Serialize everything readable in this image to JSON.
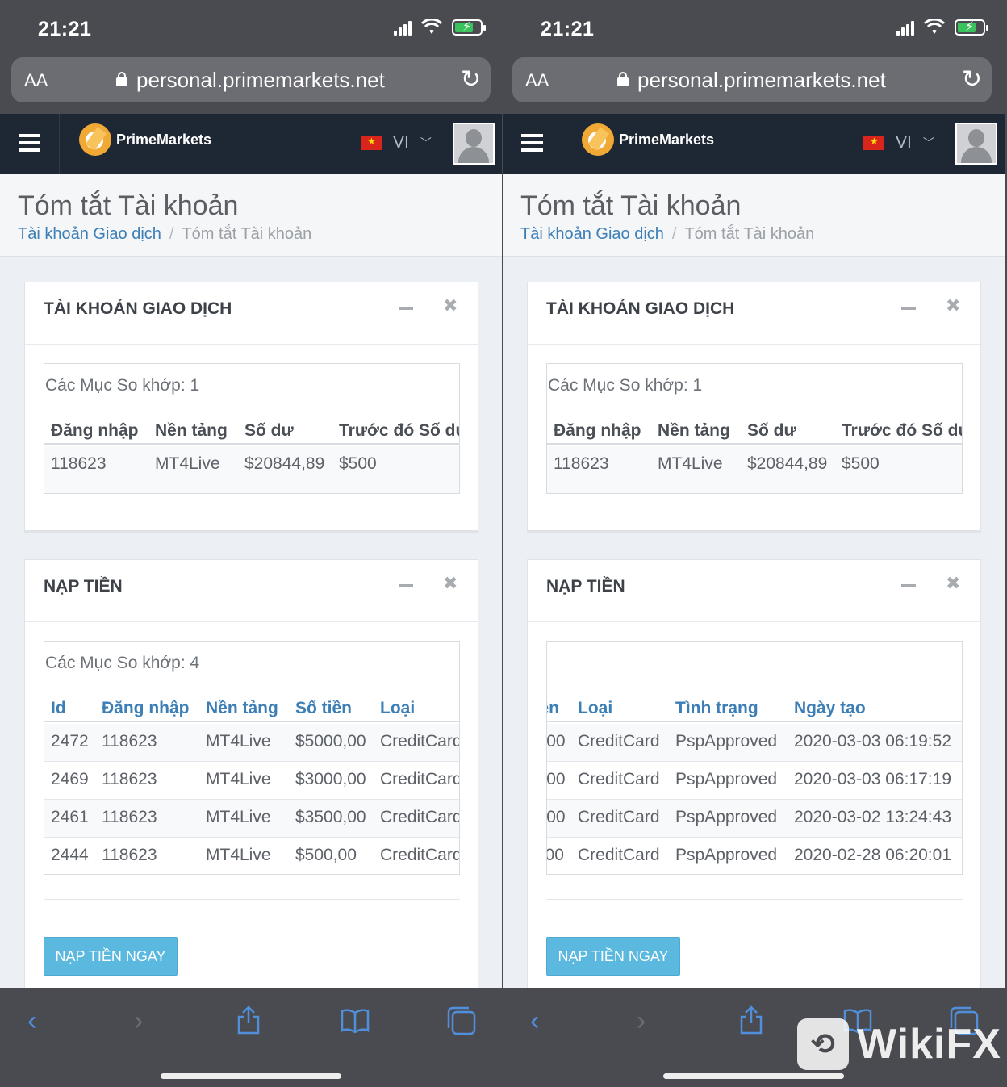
{
  "status": {
    "time": "21:21"
  },
  "browser": {
    "text_size": "AA",
    "url": "personal.primemarkets.net"
  },
  "app": {
    "brand": "PrimeMarkets",
    "language": "VI"
  },
  "page": {
    "title": "Tóm tắt Tài khoản",
    "breadcrumb": {
      "parent": "Tài khoản Giao dịch",
      "separator": "/",
      "current": "Tóm tắt Tài khoản"
    }
  },
  "trading_panel": {
    "title": "TÀI KHOẢN GIAO DỊCH",
    "count": "Các Mục So khớp: 1",
    "columns": [
      "Đăng nhập",
      "Nền tảng",
      "Số dư",
      "Trước đó Số dư"
    ],
    "rows": [
      [
        "118623",
        "MT4Live",
        "$20844,89",
        "$500"
      ]
    ]
  },
  "deposit_panel": {
    "title": "NẠP TIỀN",
    "count": "Các Mục So khớp: 4",
    "columns": [
      "Id",
      "Đăng nhập",
      "Nền tảng",
      "Số tiền",
      "Loại",
      "Tình trạng",
      "Ngày tạo"
    ],
    "rows": [
      [
        "2472",
        "118623",
        "MT4Live",
        "$5000,00",
        "CreditCard",
        "PspApproved",
        "2020-03-03 06:19:52"
      ],
      [
        "2469",
        "118623",
        "MT4Live",
        "$3000,00",
        "CreditCard",
        "PspApproved",
        "2020-03-03 06:17:19"
      ],
      [
        "2461",
        "118623",
        "MT4Live",
        "$3500,00",
        "CreditCard",
        "PspApproved",
        "2020-03-02 13:24:43"
      ],
      [
        "2444",
        "118623",
        "MT4Live",
        "$500,00",
        "CreditCard",
        "PspApproved",
        "2020-02-28 06:20:01"
      ]
    ],
    "button": "NẠP TIỀN NGAY"
  },
  "watermark": "WikiFX",
  "colors": {
    "header_bg": "#1e2835",
    "link": "#3c7eb6",
    "button": "#5bb8de",
    "logo": "#f1a936",
    "toolbar_icon": "#4f8fdc"
  }
}
